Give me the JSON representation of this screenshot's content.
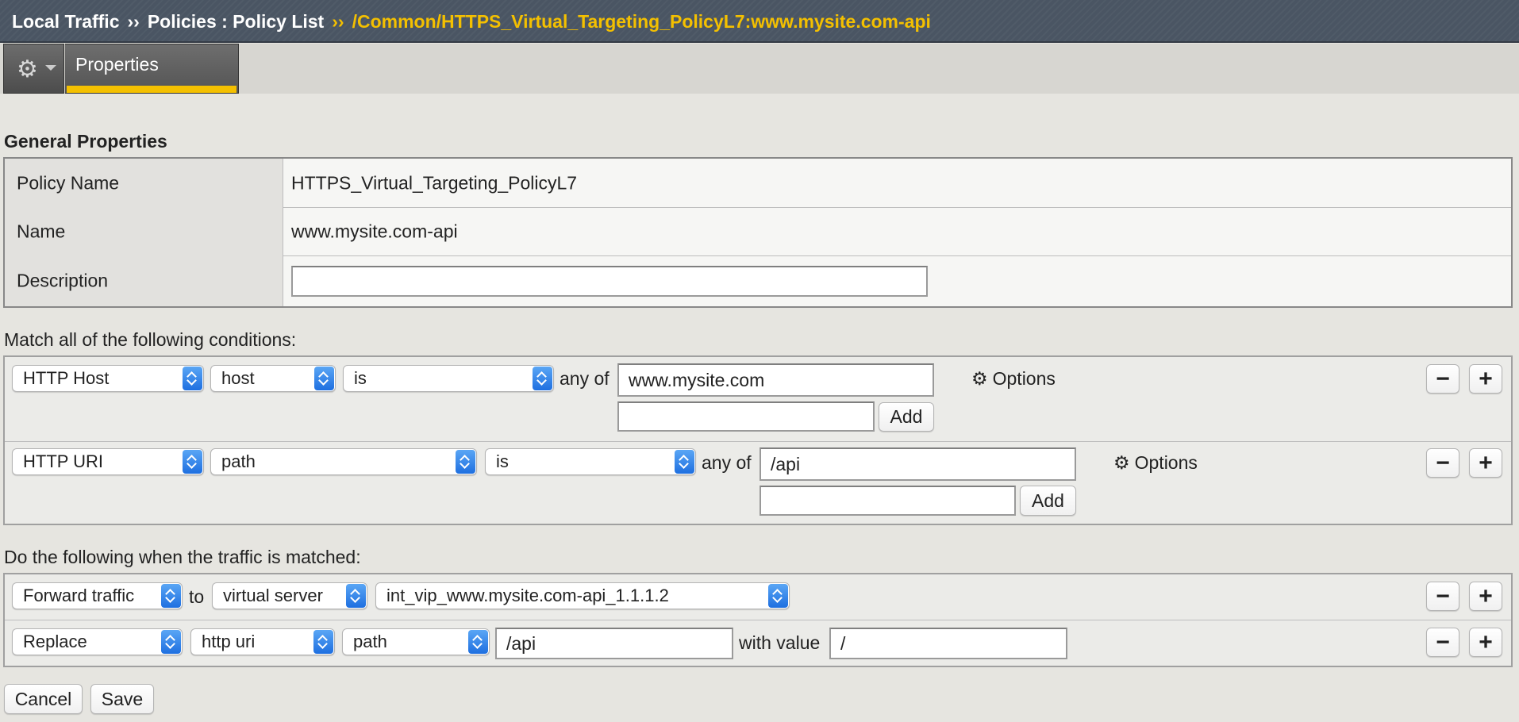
{
  "breadcrumb": {
    "section": "Local Traffic",
    "separator": "››",
    "path": "Policies : Policy List",
    "current": "/Common/HTTPS_Virtual_Targeting_PolicyL7:www.mysite.com-api"
  },
  "tabs": {
    "properties": "Properties"
  },
  "general": {
    "title": "General Properties",
    "rows": [
      {
        "label": "Policy Name",
        "value": "HTTPS_Virtual_Targeting_PolicyL7"
      },
      {
        "label": "Name",
        "value": "www.mysite.com-api"
      },
      {
        "label": "Description",
        "value": ""
      }
    ]
  },
  "conditions": {
    "heading": "Match all of the following conditions:",
    "any_of_label": "any of",
    "add_label": "Add",
    "options_label": "Options",
    "items": [
      {
        "type": "HTTP Host",
        "attribute": "host",
        "operator": "is",
        "value": "www.mysite.com",
        "new_value": ""
      },
      {
        "type": "HTTP URI",
        "attribute": "path",
        "operator": "is",
        "value": "/api",
        "new_value": ""
      }
    ]
  },
  "actions": {
    "heading": "Do the following when the traffic is matched:",
    "to_label": "to",
    "with_value_label": "with value",
    "items": [
      {
        "action": "Forward traffic",
        "target": "virtual server",
        "value": "int_vip_www.mysite.com-api_1.1.1.2"
      },
      {
        "action": "Replace",
        "target": "http uri",
        "field": "path",
        "value": "/api",
        "with_value": "/"
      }
    ]
  },
  "row_buttons": {
    "remove": "−",
    "add": "+"
  },
  "footer": {
    "cancel": "Cancel",
    "save": "Save"
  },
  "colors": {
    "header_bg": "#4a5563",
    "accent": "#f4c000",
    "select_arrow": "#2a7ae8"
  },
  "icons": {
    "gear": "⚙"
  }
}
